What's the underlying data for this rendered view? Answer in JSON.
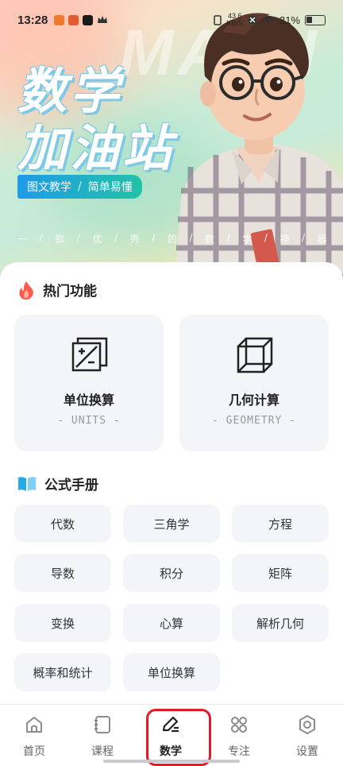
{
  "status_bar": {
    "time": "13:28",
    "speed_value": "43.6",
    "speed_unit": "KB/S",
    "battery": "31%"
  },
  "hero": {
    "watermark": "MATH",
    "title_line1": "数学",
    "title_line2": "加油站",
    "tag_left": "图文教学",
    "tag_sep": "/",
    "tag_right": "简单易懂",
    "slogan": [
      "一",
      "/",
      "款",
      "/",
      "优",
      "/",
      "秀",
      "/",
      "的",
      "/",
      "数",
      "/",
      "学",
      "/",
      "神",
      "/",
      "器"
    ]
  },
  "hot": {
    "title": "热门功能",
    "features": [
      {
        "name": "单位换算",
        "sub": "- UNITS -",
        "icon": "unit-convert-icon"
      },
      {
        "name": "几何计算",
        "sub": "- GEOMETRY -",
        "icon": "cube-icon"
      }
    ]
  },
  "formula": {
    "title": "公式手册",
    "items": [
      "代数",
      "三角学",
      "方程",
      "导数",
      "积分",
      "矩阵",
      "变换",
      "心算",
      "解析几何",
      "概率和统计",
      "单位换算"
    ]
  },
  "nav": {
    "items": [
      {
        "label": "首页",
        "icon": "home-icon"
      },
      {
        "label": "课程",
        "icon": "notebook-icon"
      },
      {
        "label": "数学",
        "icon": "pen-icon"
      },
      {
        "label": "专注",
        "icon": "grid-icon"
      },
      {
        "label": "设置",
        "icon": "settings-icon"
      }
    ],
    "active": 2
  },
  "colors": {
    "accent_red": "#e21a2a",
    "tag_gradient_start": "#1f9be8",
    "tag_gradient_end": "#22c3a8",
    "fire": "#ff5a4a",
    "book": "#2aa9e8"
  }
}
